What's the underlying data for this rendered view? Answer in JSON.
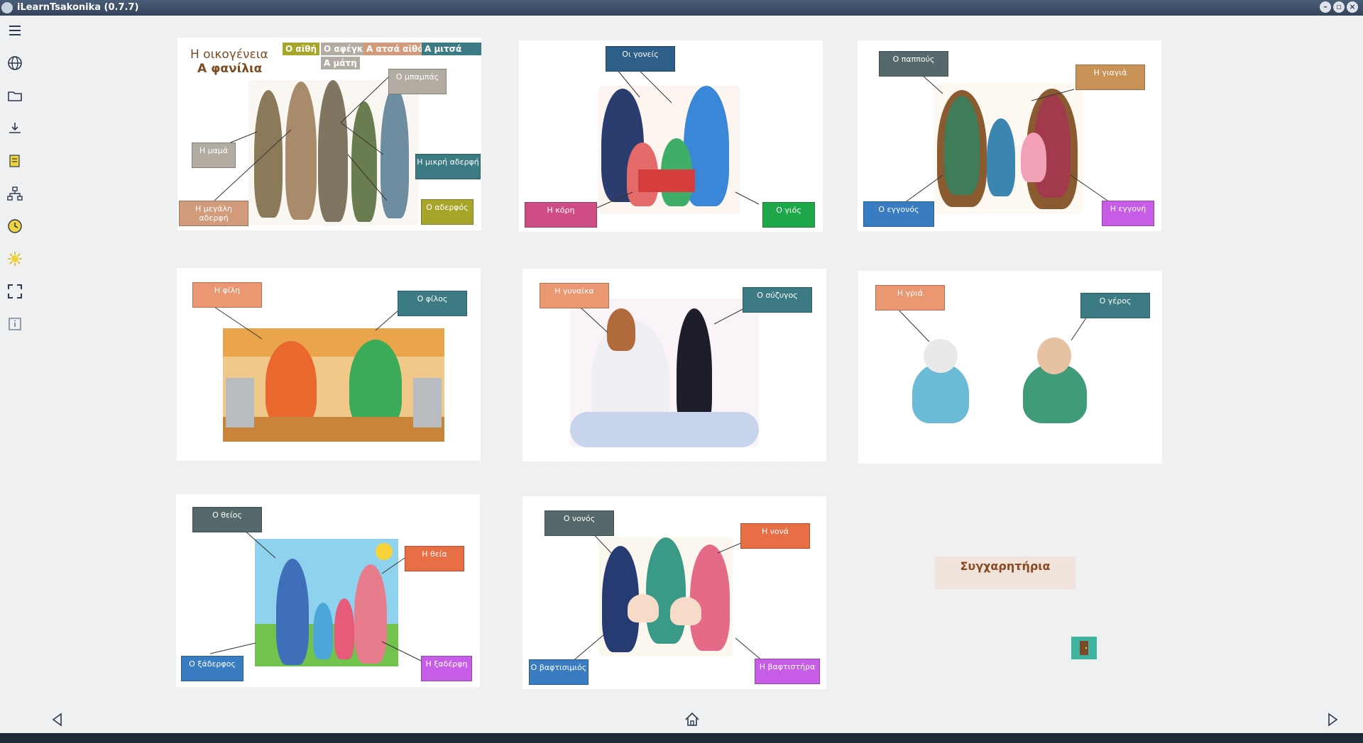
{
  "window": {
    "title": "iLearnTsakonika (0.7.7)"
  },
  "sidebar": {
    "items": [
      {
        "icon": "menu-icon"
      },
      {
        "icon": "globe-icon"
      },
      {
        "icon": "folder-icon"
      },
      {
        "icon": "download-icon"
      },
      {
        "icon": "edit-note-icon"
      },
      {
        "icon": "hierarchy-icon"
      },
      {
        "icon": "clock-icon"
      },
      {
        "icon": "brightness-icon"
      },
      {
        "icon": "fullscreen-icon"
      },
      {
        "icon": "info-icon"
      }
    ]
  },
  "cards": {
    "family": {
      "title1": "Η οικογένεια",
      "title2": "Α φανίλια",
      "chips": [
        "Ο αϊθή",
        "Ο αφέγκη",
        "Α ατσά αϊθά",
        "Α μιτσά αϊθά",
        "Α μάτη"
      ],
      "labels": {
        "mother": "Η μαμά",
        "father": "Ο μπαμπάς",
        "big_sister": "Η μεγάλη αδερφή",
        "little_sister": "Η μικρή αδερφή",
        "brother": "Ο αδερφός"
      }
    },
    "parents": {
      "labels": {
        "parents": "Οι γονείς",
        "daughter": "Η κόρη",
        "son": "Ο γιός"
      }
    },
    "grandparents": {
      "labels": {
        "grandfather": "Ο παππούς",
        "grandmother": "Η γιαγιά",
        "grandson": "Ο εγγονός",
        "granddaughter": "Η εγγονή"
      }
    },
    "friends": {
      "labels": {
        "girlfriend": "Η φίλη",
        "boyfriend": "Ο φίλος"
      }
    },
    "wedding": {
      "labels": {
        "wife": "Η γυναίκα",
        "husband": "Ο σύζυγος"
      }
    },
    "elders": {
      "labels": {
        "old_woman": "Η γριά",
        "old_man": "Ο γέρος"
      }
    },
    "uncle": {
      "labels": {
        "uncle": "Ο θείος",
        "aunt": "Η θεία",
        "cousin_m": "Ο ξάδερφος",
        "cousin_f": "Η ξαδέρφη"
      }
    },
    "baptism": {
      "labels": {
        "godfather": "Ο νονός",
        "godmother": "Η νονά",
        "godson": "Ο βαφτισιμιός",
        "goddaughter": "Η βαφτιστήρα"
      }
    }
  },
  "congrats": "Συγχαρητήρια",
  "colors": {
    "slate": "#56696a",
    "tan": "#c99257",
    "teal": "#3c7b84",
    "salmon": "#eb9872",
    "blue": "#3a7cc2",
    "magenta": "#cd4d84",
    "green": "#1fa84a",
    "violet": "#c75de6",
    "olive": "#a7a62b",
    "gray": "#b2aca2",
    "navy": "#2d5f8a",
    "peach": "#d19b7c"
  }
}
